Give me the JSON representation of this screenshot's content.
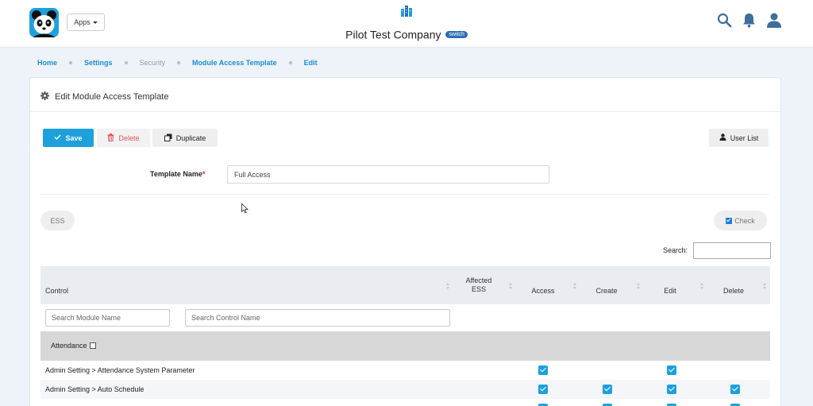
{
  "header": {
    "apps_label": "Apps",
    "company_name": "Pilot Test Company",
    "switch_label": "switch",
    "icons": [
      "panda-logo-icon",
      "building-icon",
      "search-icon",
      "bell-icon",
      "user-icon"
    ],
    "accent_color": "#1ea0dc"
  },
  "breadcrumb": [
    "Home",
    "Settings",
    "Security",
    "Module Access Template",
    "Edit"
  ],
  "page": {
    "title": "Edit Module Access Template",
    "title_icon": "gear-icon"
  },
  "toolbar": {
    "save_label": "Save",
    "delete_label": "Delete",
    "duplicate_label": "Duplicate",
    "userlist_label": "User List"
  },
  "form": {
    "template_name_label": "Template Name",
    "required_mark": "*",
    "template_name_value": "Full Access"
  },
  "filters": {
    "ess_label": "ESS",
    "check_label": "Check",
    "search_label": "Search:"
  },
  "table": {
    "columns": {
      "control": "Control",
      "affected_ess_line1": "Affected",
      "affected_ess_line2": "ESS",
      "access": "Access",
      "create": "Create",
      "edit": "Edit",
      "delete": "Delete"
    },
    "module_search_placeholder": "Search Module Name",
    "control_search_placeholder": "Search Control Name",
    "group": "Attendance",
    "rows": [
      {
        "label": "Admin Setting > Attendance System Parameter",
        "access": true,
        "create": false,
        "edit": true,
        "delete": false
      },
      {
        "label": "Admin Setting > Auto Schedule",
        "access": true,
        "create": true,
        "edit": true,
        "delete": true
      }
    ]
  }
}
